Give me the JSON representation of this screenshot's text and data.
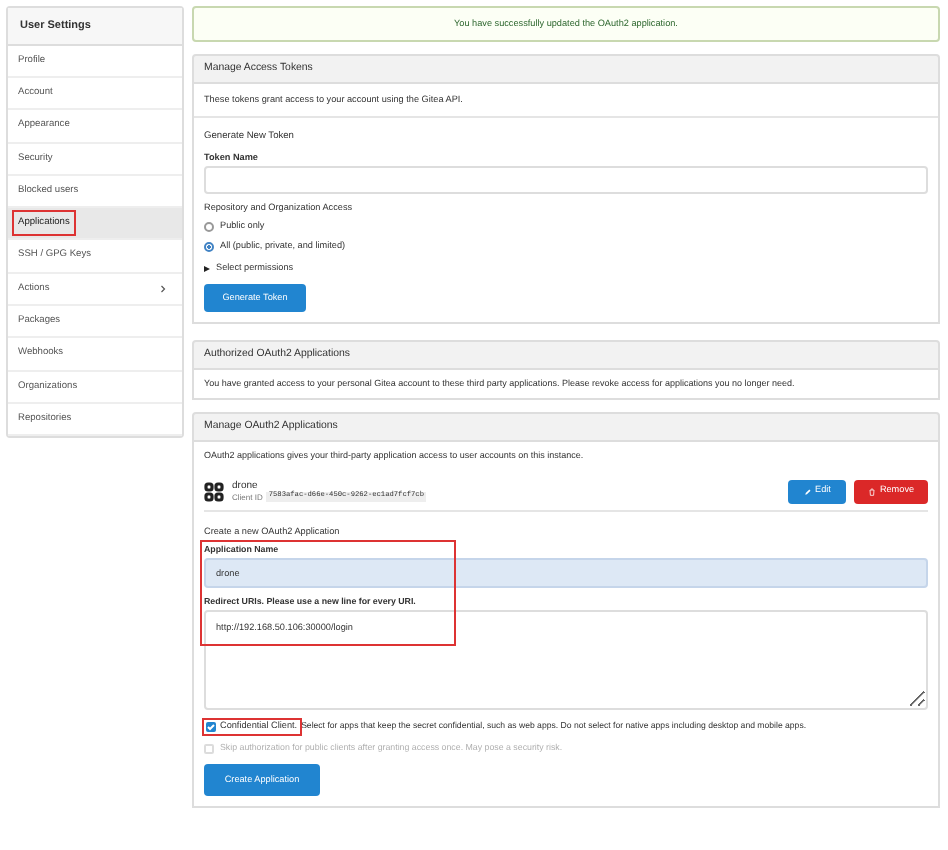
{
  "sidebar": {
    "title": "User Settings",
    "items": [
      {
        "label": "Profile",
        "selected": false,
        "highlighted": false
      },
      {
        "label": "Account",
        "selected": false,
        "highlighted": false
      },
      {
        "label": "Appearance",
        "selected": false,
        "highlighted": false
      },
      {
        "label": "Security",
        "selected": false,
        "highlighted": false
      },
      {
        "label": "Blocked users",
        "selected": false,
        "highlighted": false
      },
      {
        "label": "Applications",
        "selected": true,
        "highlighted": true
      },
      {
        "label": "SSH / GPG Keys",
        "selected": false,
        "highlighted": false
      },
      {
        "label": "Actions",
        "selected": false,
        "highlighted": false,
        "submenu": true
      },
      {
        "label": "Packages",
        "selected": false,
        "highlighted": false
      },
      {
        "label": "Webhooks",
        "selected": false,
        "highlighted": false
      },
      {
        "label": "Organizations",
        "selected": false,
        "highlighted": false
      },
      {
        "label": "Repositories",
        "selected": false,
        "highlighted": false
      }
    ]
  },
  "flash": "You have successfully updated the OAuth2 application.",
  "access_tokens": {
    "title": "Manage Access Tokens",
    "description": "These tokens grant access to your account using the Gitea API.",
    "form_title": "Generate New Token",
    "token_name_label": "Token Name",
    "access_label": "Repository and Organization Access",
    "options": [
      {
        "label": "Public only",
        "selected": false
      },
      {
        "label": "All (public, private, and limited)",
        "selected": true
      }
    ],
    "permissions_toggle": "Select permissions",
    "button": "Generate Token"
  },
  "authorized": {
    "title": "Authorized OAuth2 Applications",
    "description": "You have granted access to your personal Gitea account to these third party applications. Please revoke access for applications you no longer need."
  },
  "oauth2": {
    "title": "Manage OAuth2 Applications",
    "description": "OAuth2 applications gives your third-party application access to user accounts on this instance.",
    "apps": [
      {
        "name": "drone",
        "client_id_label": "Client ID",
        "client_id": "7583afac-d66e-450c-9262-ec1ad7fcf7cb",
        "edit": "Edit",
        "remove": "Remove"
      }
    ],
    "form": {
      "title": "Create a new OAuth2 Application",
      "highlighted": true,
      "name_label": "Application Name",
      "name_value": "drone",
      "redirect_label": "Redirect URIs. Please use a new line for every URI.",
      "redirect_value": "http://192.168.50.106:30000/login",
      "confidential": {
        "label": "Confidential Client.",
        "hint": "Select for apps that keep the secret confidential, such as web apps. Do not select for native apps including desktop and mobile apps.",
        "checked": true,
        "highlighted": true
      },
      "skip_auth": {
        "label": "Skip authorization for public clients after granting access once. May pose a security risk.",
        "checked": false,
        "disabled": true
      },
      "button": "Create Application"
    }
  }
}
